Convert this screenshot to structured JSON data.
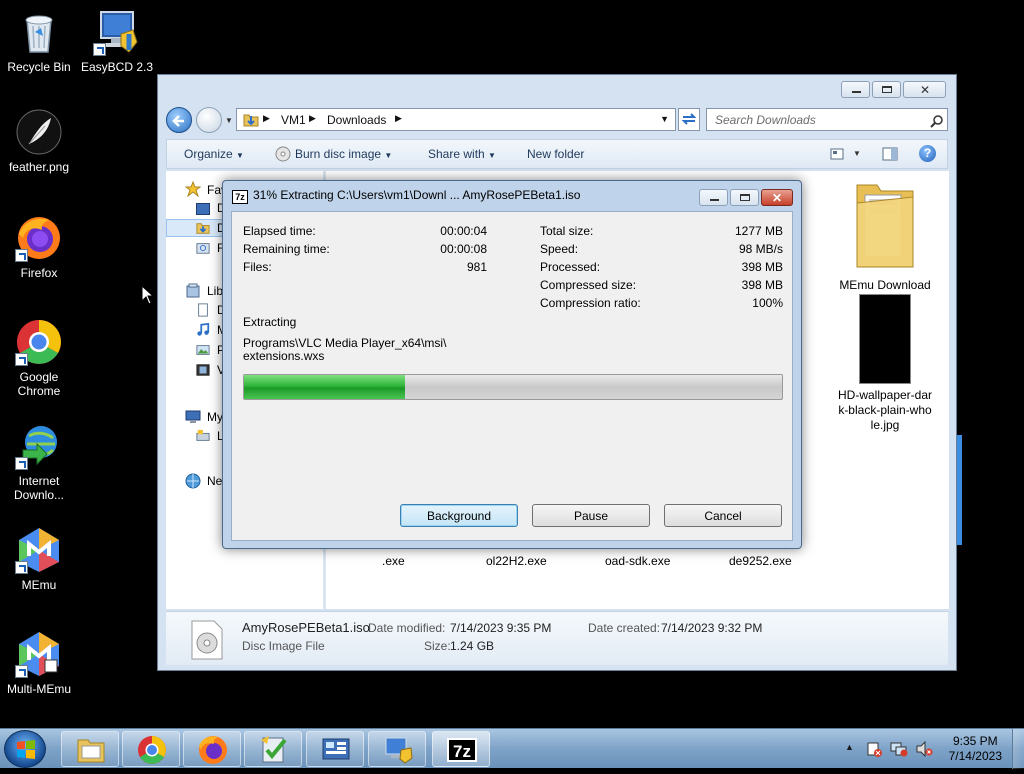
{
  "desktop": {
    "icons": [
      {
        "label": "Recycle Bin"
      },
      {
        "label": "EasyBCD 2.3"
      },
      {
        "label": "feather.png"
      },
      {
        "label": "Firefox"
      },
      {
        "label": "Google Chrome"
      },
      {
        "label": "Internet Downlo..."
      },
      {
        "label": "MEmu"
      },
      {
        "label": "Multi-MEmu"
      }
    ]
  },
  "explorer": {
    "breadcrumb": [
      "VM1",
      "Downloads"
    ],
    "search_placeholder": "Search Downloads",
    "toolbar": {
      "organize": "Organize",
      "burn": "Burn disc image",
      "share": "Share with",
      "new_folder": "New folder"
    },
    "nav": {
      "favorites": "Fav",
      "fav_items": [
        "D",
        "D",
        "R"
      ],
      "libraries": "Lib",
      "lib_items": [
        "D",
        "M",
        "P",
        "V"
      ],
      "computer": "My",
      "computer_items": [
        "L"
      ],
      "network": "Ne"
    },
    "files": [
      {
        "name": "MEmu Download"
      },
      {
        "name": "HD-wallpaper-dark-black-plain-whole.jpg"
      }
    ],
    "partial_files": [
      ".exe",
      "ol22H2.exe",
      "oad-sdk.exe",
      "de9252.exe"
    ],
    "details": {
      "filename": "AmyRosePEBeta1.iso",
      "type": "Disc Image File",
      "date_modified_label": "Date modified:",
      "date_modified": "7/14/2023 9:35 PM",
      "size_label": "Size:",
      "size": "1.24 GB",
      "date_created_label": "Date created:",
      "date_created": "7/14/2023 9:32 PM"
    }
  },
  "dialog": {
    "title": "31% Extracting C:\\Users\\vm1\\Downl ... AmyRosePEBeta1.iso",
    "left_stats": [
      {
        "label": "Elapsed time:",
        "value": "00:00:04"
      },
      {
        "label": "Remaining time:",
        "value": "00:00:08"
      },
      {
        "label": "Files:",
        "value": "981"
      }
    ],
    "right_stats": [
      {
        "label": "Total size:",
        "value": "1277 MB"
      },
      {
        "label": "Speed:",
        "value": "98 MB/s"
      },
      {
        "label": "Processed:",
        "value": "398 MB"
      },
      {
        "label": "Compressed size:",
        "value": "398 MB"
      },
      {
        "label": "Compression ratio:",
        "value": "100%"
      }
    ],
    "action": "Extracting",
    "path_line1": "Programs\\VLC Media Player_x64\\msi\\",
    "path_line2": "extensions.wxs",
    "progress": 0.3,
    "buttons": {
      "background": "Background",
      "pause": "Pause",
      "cancel": "Cancel"
    }
  },
  "taskbar": {
    "time": "9:35 PM",
    "date": "7/14/2023",
    "seven_zip_label": "7z"
  }
}
